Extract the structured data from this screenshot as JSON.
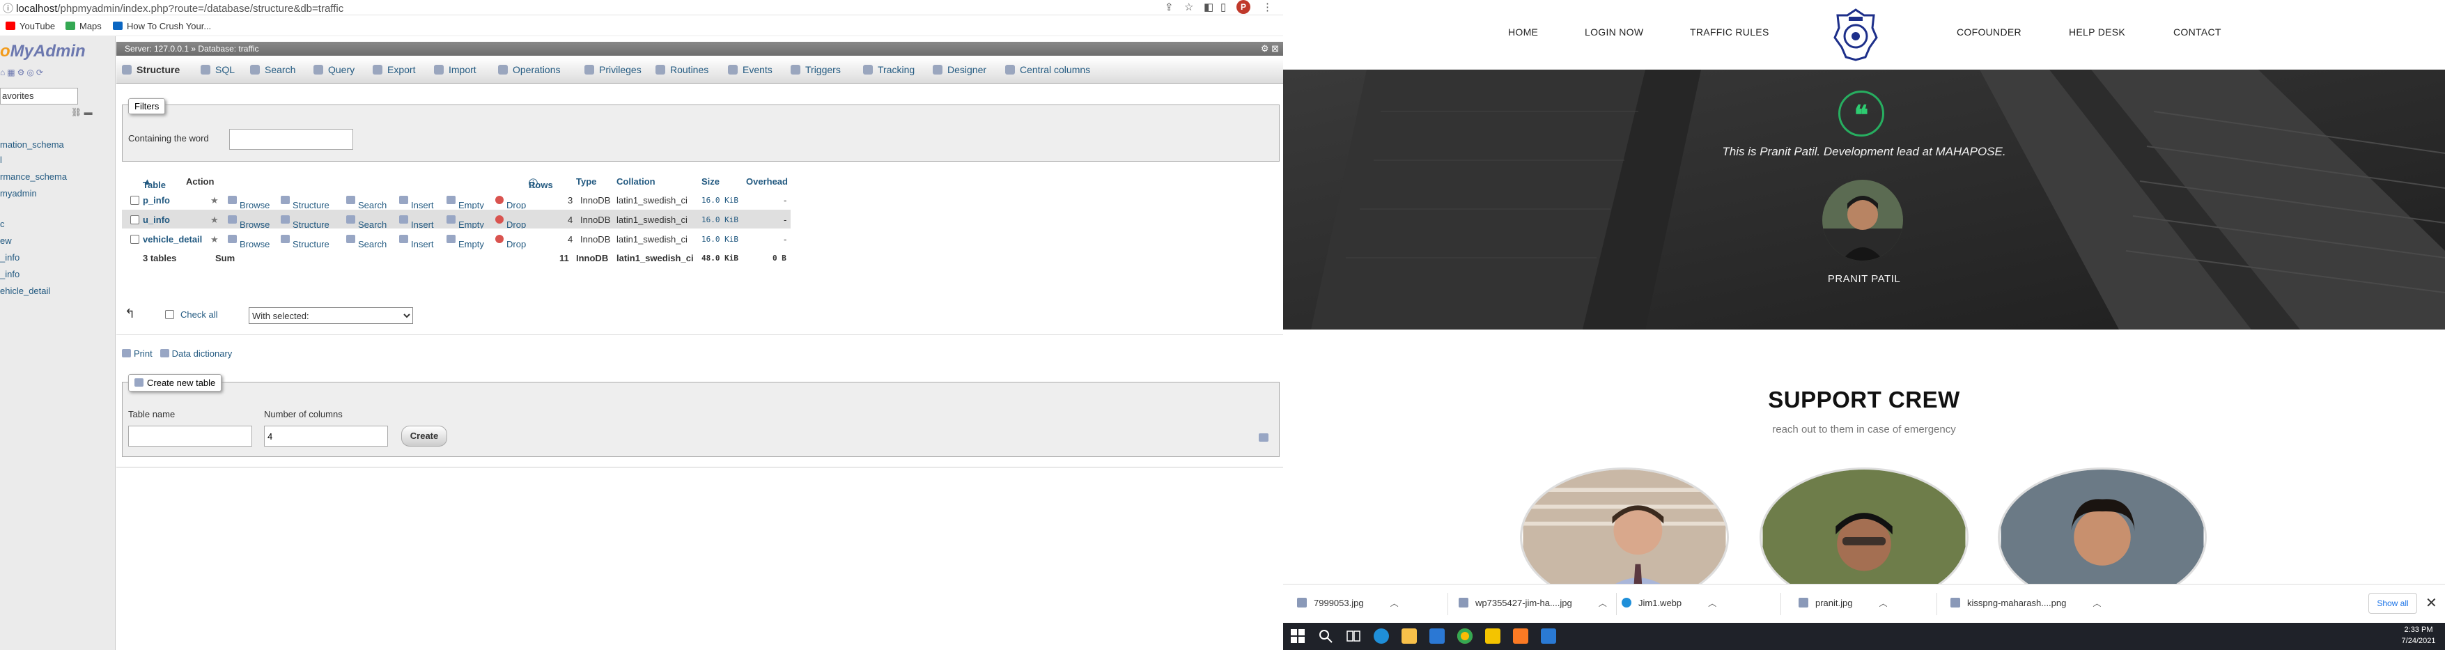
{
  "browser": {
    "url_host": "localhost",
    "url_path": "/phpmyadmin/index.php?route=/database/structure&db=traffic",
    "profile_initial": "P",
    "bookmarks": [
      {
        "label": "YouTube",
        "color": "#ff0000"
      },
      {
        "label": "Maps",
        "color": "#34a853"
      },
      {
        "label": "How To Crush Your...",
        "color": "#0a66c2"
      }
    ]
  },
  "pma": {
    "logo_text_a": "o",
    "logo_text_b": "MyAdmin",
    "favorites_label": "avorites",
    "databases": [
      "mation_schema",
      "l",
      "rmance_schema",
      "myadmin",
      "c",
      "ew",
      "_info",
      "_info",
      "ehicle_detail"
    ],
    "breadcrumb": "Server: 127.0.0.1 » Database: traffic",
    "tabs": [
      "Structure",
      "SQL",
      "Search",
      "Query",
      "Export",
      "Import",
      "Operations",
      "Privileges",
      "Routines",
      "Events",
      "Triggers",
      "Tracking",
      "Designer",
      "Central columns"
    ],
    "filters": {
      "legend": "Filters",
      "label": "Containing the word",
      "value": ""
    },
    "table_headers": {
      "table": "Table",
      "action": "Action",
      "rows": "Rows",
      "type": "Type",
      "collation": "Collation",
      "size": "Size",
      "overhead": "Overhead"
    },
    "actions": {
      "browse": "Browse",
      "structure": "Structure",
      "search": "Search",
      "insert": "Insert",
      "empty": "Empty",
      "drop": "Drop"
    },
    "tables": [
      {
        "name": "p_info",
        "rows": "3",
        "type": "InnoDB",
        "collation": "latin1_swedish_ci",
        "size": "16.0 KiB",
        "overhead": "-"
      },
      {
        "name": "u_info",
        "rows": "4",
        "type": "InnoDB",
        "collation": "latin1_swedish_ci",
        "size": "16.0 KiB",
        "overhead": "-"
      },
      {
        "name": "vehicle_detail",
        "rows": "4",
        "type": "InnoDB",
        "collation": "latin1_swedish_ci",
        "size": "16.0 KiB",
        "overhead": "-"
      }
    ],
    "summary": {
      "tables": "3 tables",
      "label": "Sum",
      "rows": "11",
      "type": "InnoDB",
      "collation": "latin1_swedish_ci",
      "size": "48.0 KiB",
      "overhead": "0 B"
    },
    "check_all": "Check all",
    "with_selected": "With selected:",
    "print": "Print",
    "data_dictionary": "Data dictionary",
    "create_table": {
      "legend": "Create new table",
      "name_label": "Table name",
      "columns_label": "Number of columns",
      "columns_value": "4",
      "button": "Create"
    }
  },
  "site": {
    "nav": [
      "HOME",
      "LOGIN NOW",
      "TRAFFIC RULES",
      "COFOUNDER",
      "HELP DESK",
      "CONTACT"
    ],
    "testimonial_icon": "❝",
    "testimonial": "This is Pranit Patil. Development lead at MAHAPOSE.",
    "person_name": "PRANIT PATIL",
    "crew_heading": "SUPPORT CREW",
    "crew_sub": "reach out to them in case of emergency"
  },
  "downloads": {
    "items": [
      "7999053.jpg",
      "wp7355427-jim-ha....jpg",
      "Jim1.webp",
      "pranit.jpg",
      "kisspng-maharash....png"
    ],
    "show_all": "Show all",
    "close": "✕"
  },
  "taskbar": {
    "time": "2:33 PM",
    "date": "7/24/2021"
  },
  "colors": {
    "pma_link": "#235a81",
    "accent_green": "#27ae60",
    "taskbar": "#1f2229"
  }
}
